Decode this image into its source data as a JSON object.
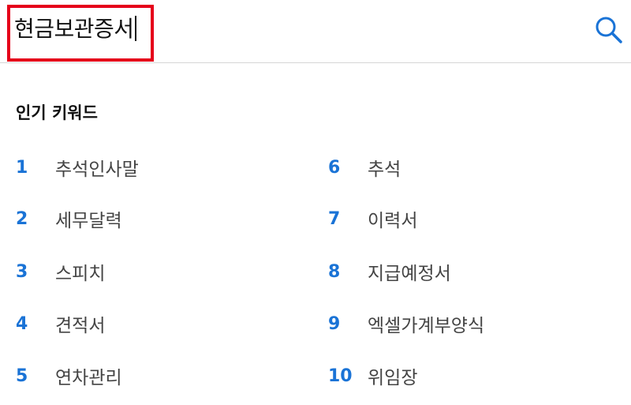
{
  "search": {
    "value": "현금보관증서",
    "icon": "search-icon",
    "highlight_color": "#e5001a"
  },
  "popular": {
    "title": "인기 키워드",
    "rank_color": "#1a73d6",
    "keywords": [
      {
        "rank": "1",
        "text": "추석인사말"
      },
      {
        "rank": "2",
        "text": "세무달력"
      },
      {
        "rank": "3",
        "text": "스피치"
      },
      {
        "rank": "4",
        "text": "견적서"
      },
      {
        "rank": "5",
        "text": "연차관리"
      },
      {
        "rank": "6",
        "text": "추석"
      },
      {
        "rank": "7",
        "text": "이력서"
      },
      {
        "rank": "8",
        "text": "지급예정서"
      },
      {
        "rank": "9",
        "text": "엑셀가계부양식"
      },
      {
        "rank": "10",
        "text": "위임장"
      }
    ]
  }
}
